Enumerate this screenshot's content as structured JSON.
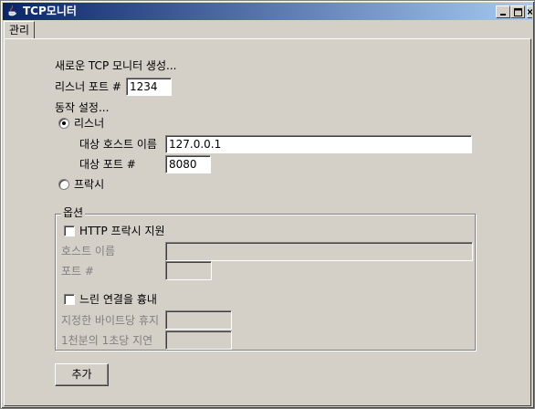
{
  "window": {
    "title": "TCP모니터",
    "minimize_label": "_",
    "close_label": "×"
  },
  "tabs": [
    {
      "label": "관리"
    }
  ],
  "form": {
    "section_title": "새로운 TCP 모니터 생성...",
    "listener_port_label": "리스너 포트 #",
    "listener_port_value": "1234",
    "action_settings_label": "동작 설정...",
    "radio_listener_label": "리스너",
    "target_host_label": "대상 호스트 이름",
    "target_host_value": "127.0.0.1",
    "target_port_label": "대상 포트 #",
    "target_port_value": "8080",
    "radio_proxy_label": "프락시",
    "mode_selected": "리스너"
  },
  "options": {
    "group_title": "옵션",
    "http_proxy_label": "HTTP 프락시 지원",
    "http_proxy_checked": false,
    "hostname_label": "호스트 이름",
    "hostname_value": "",
    "port_label": "포트 #",
    "port_value": "",
    "slow_connection_label": "느린 연결을 흉내",
    "slow_connection_checked": false,
    "bytes_pause_label": "지정한 바이트당 휴지",
    "bytes_pause_value": "",
    "delay_label": "1천분의 1초당 지연",
    "delay_value": ""
  },
  "actions": {
    "add_label": "추가"
  }
}
